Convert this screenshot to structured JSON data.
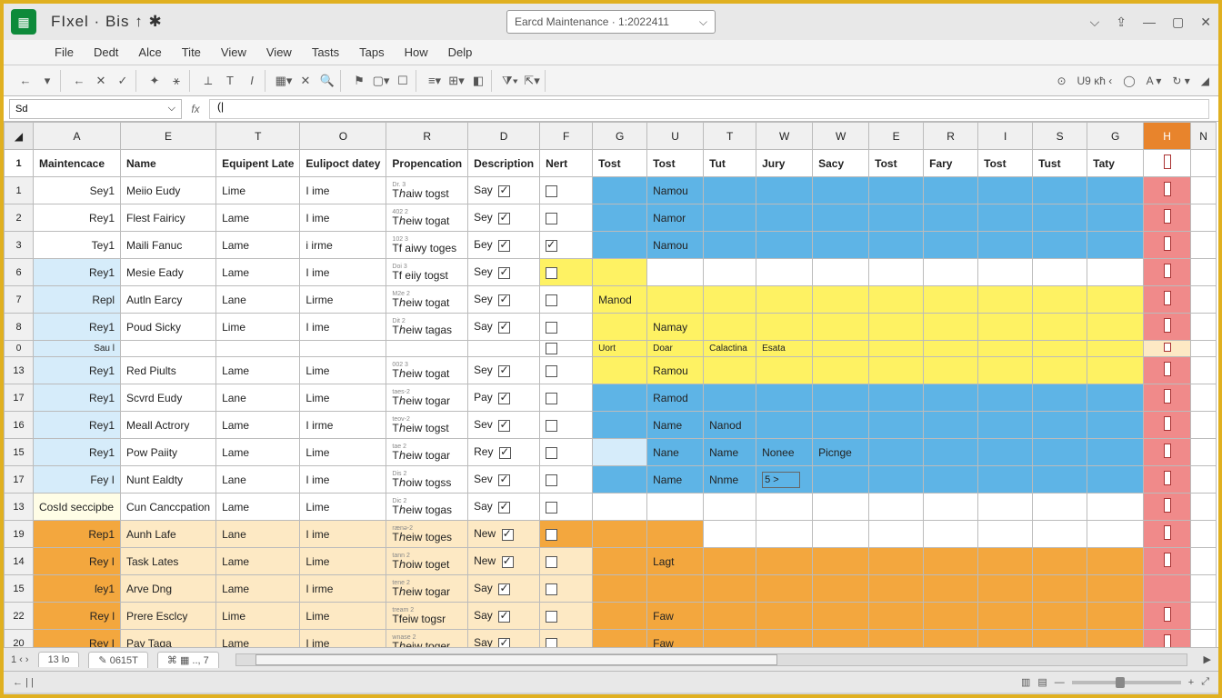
{
  "title_left": "FIxel ·  Bis  ↑ ✱",
  "doc_title": "Earcd Maintenance · 1:2022411",
  "menu": [
    "File",
    "Dedt",
    "Alce",
    "Tite",
    "View",
    "View",
    "Tasts",
    "Taps",
    "How",
    "Delp"
  ],
  "name_box": "Sd",
  "formula": "(|",
  "col_headers": [
    "A",
    "E",
    "T",
    "O",
    "R",
    "D",
    "F",
    "G",
    "U",
    "T",
    "W",
    "W",
    "E",
    "R",
    "I",
    "S",
    "G",
    "H",
    "N"
  ],
  "header_row": [
    "Maintencace",
    "Name",
    "Equipent Late",
    "Eulipoct datey",
    "Propencation",
    "Description",
    "Nert",
    "Tost",
    "Tost",
    "Tut",
    "Jury",
    "Sacy",
    "Tost",
    "Fary",
    "Tost",
    "Tust",
    "Taty",
    ""
  ],
  "rows": [
    {
      "n": "1",
      "a": "Sey1",
      "e": "Meiio Eudy",
      "t": "Lime",
      "o": "I ime",
      "sup": "Dr. 3",
      "r": "Tℎaiw togst",
      "d": "Say",
      "dc": true,
      "f": false,
      "g": "",
      "u": "Namou",
      "fill": "blue",
      "afill": ""
    },
    {
      "n": "2",
      "a": "Rey1",
      "e": "Flest Fairicy",
      "t": "Lame",
      "o": "I ime",
      "sup": "402 2",
      "r": "Tℎeiw togat",
      "d": "Sey",
      "dc": true,
      "f": false,
      "g": "",
      "u": "Namor",
      "fill": "blue",
      "afill": ""
    },
    {
      "n": "3",
      "a": "Tey1",
      "e": "Maili Fanuc",
      "t": "Lame",
      "o": "i irme",
      "sup": "102 3",
      "r": "Tf aiwy toges",
      "d": "Бey",
      "dc": true,
      "f": true,
      "g": "",
      "u": "Namou",
      "fill": "blue",
      "afill": ""
    },
    {
      "n": "6",
      "a": "Rey1",
      "e": "Mesie Eady",
      "t": "Lame",
      "o": "I ime",
      "sup": "Doi 3",
      "r": "Tf eiiy togst",
      "d": "Sey",
      "dc": true,
      "f": false,
      "g": "",
      "u": "",
      "fill": "yellow1",
      "afill": "lblue"
    },
    {
      "n": "7",
      "a": "Repl",
      "e": "Autln Earcy",
      "t": "Lane",
      "o": "Lirme",
      "sup": "M2e 2",
      "r": "Tℎeiw togat",
      "d": "Sey",
      "dc": true,
      "f": false,
      "g": "Manod",
      "u": "",
      "fill": "yellow",
      "afill": "lblue"
    },
    {
      "n": "8",
      "a": "Rey1",
      "e": "Poud Sicky",
      "t": "Lime",
      "o": "I ime",
      "sup": "Dit 2",
      "r": "Tℎeiw tagas",
      "d": "Say",
      "dc": true,
      "f": false,
      "g": "",
      "u": "Namay",
      "fill": "yellow",
      "afill": "lblue"
    },
    {
      "n": "0",
      "partial": true,
      "a": "Sau l",
      "g": "Uort",
      "u": "Doar",
      "tt": "Calactina",
      "w": "Esata"
    },
    {
      "n": "13",
      "a": "Rey1",
      "e": "Red Piults",
      "t": "Lame",
      "o": "Lime",
      "sup": "002 3",
      "r": "Tℎeiw togat",
      "d": "Sey",
      "dc": true,
      "f": false,
      "g": "",
      "u": "Ramou",
      "fill": "yellow",
      "afill": "lblue"
    },
    {
      "n": "17",
      "a": "Rey1",
      "e": "Scvrd Eudy",
      "t": "Lane",
      "o": "Lime",
      "sup": "taes-2",
      "r": "Tℎeiw togar",
      "d": "Pay",
      "dc": true,
      "f": false,
      "g": "",
      "u": "Ramod",
      "fill": "blue",
      "afill": "lblue"
    },
    {
      "n": "16",
      "a": "Rey1",
      "e": "Meall Actrory",
      "t": "Lame",
      "o": "I irme",
      "sup": "teov-2",
      "r": "Tℎeiw togst",
      "d": "Sev",
      "dc": true,
      "f": false,
      "g": "",
      "u": "Name",
      "tt": "Nanod",
      "fill": "blue",
      "afill": "lblue"
    },
    {
      "n": "15",
      "a": "Rey1",
      "e": "Pow Paiity",
      "t": "Lame",
      "o": "Lime",
      "sup": "tae 2",
      "r": "Tℎeiw togar",
      "d": "Rey",
      "dc": true,
      "f": false,
      "g": "",
      "u": "Nane",
      "tt": "Name",
      "w": "Nonee",
      "w2": "Picnge",
      "fill": "blue",
      "afill": "lblue",
      "gfill": "lblue"
    },
    {
      "n": "17",
      "a": "Fey I",
      "e": "Nunt Ealdty",
      "t": "Lane",
      "o": "I ime",
      "sup": "Dis 2",
      "r": "Tℎoiw togss",
      "d": "Sev",
      "dc": true,
      "f": false,
      "g": "",
      "u": "Name",
      "tt": "Nnme",
      "w": "",
      "winput": "5    >",
      "fill": "blue",
      "afill": "lblue"
    },
    {
      "n": "13",
      "a": "CosId seccipbe",
      "e": "Cun Canccpation",
      "t": "Lame",
      "o": "Lime",
      "sup": "Dic 2",
      "r": "Tℎeiw togas",
      "d": "Say",
      "dc": true,
      "f": false,
      "fill": "",
      "afill": "lyellow",
      "full": true
    },
    {
      "n": "19",
      "a": "Rep1",
      "e": "Aunh Lafe",
      "t": "Lane",
      "o": "I ime",
      "sup": "rænə-2",
      "r": "Tℎeiw toges",
      "d": "New",
      "dc": true,
      "f": false,
      "g": "",
      "u": "",
      "fill": "orange1",
      "afill": "orange",
      "efill": "lorange"
    },
    {
      "n": "14",
      "a": "Rey I",
      "e": "Task Lates",
      "t": "Lame",
      "o": "Lime",
      "sup": "tann 2",
      "r": "Tℎoiw toget",
      "d": "New",
      "dc": true,
      "f": false,
      "g": "",
      "u": "Lagt",
      "fill": "orange",
      "afill": "orange",
      "efill": "lorange"
    },
    {
      "n": "15",
      "a": "ſey1",
      "e": "Arve Dng",
      "t": "Lame",
      "o": "I irme",
      "sup": "tene 2",
      "r": "Tℎeiw togar",
      "d": "Say",
      "dc": true,
      "f": false,
      "fill": "orange",
      "afill": "orange",
      "efill": "lorange",
      "noind": true
    },
    {
      "n": "22",
      "a": "Rey l",
      "e": "Prere Esclcy",
      "t": "Lime",
      "o": "Lime",
      "sup": "tream 2",
      "r": "Tfeiw togsr",
      "d": "Say",
      "dc": true,
      "f": false,
      "g": "",
      "u": "Faw",
      "fill": "orange",
      "afill": "orange",
      "efill": "lorange"
    },
    {
      "n": "20",
      "a": "Rey I",
      "e": "Pay Taga",
      "t": "Lame",
      "o": "I ime",
      "sup": "wnase 2",
      "r": "Tℎeiw toger",
      "d": "Say",
      "dc": true,
      "f": false,
      "g": "",
      "u": "Faw",
      "fill": "orange",
      "afill": "orange",
      "efill": "lorange"
    }
  ],
  "tabs": {
    "nav": "1 ‹  ›",
    "sheet1": "13 lo",
    "sheet2": "✎ 0615T",
    "sheet3": "⌘ ▦ .., 7"
  },
  "status_left": "← | |",
  "tool_right_label": "U9 ᴋħ   ‹"
}
